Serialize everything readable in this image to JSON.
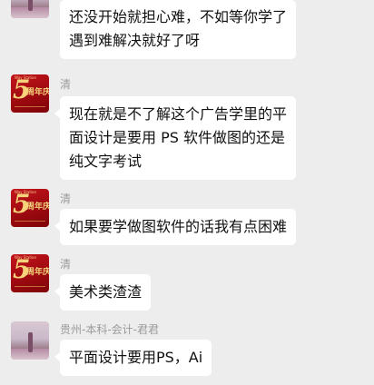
{
  "messages": [
    {
      "sender": "",
      "avatar": "photo-avatar",
      "lines": [
        "还没开始就担心难，不如等你学了",
        "遇到难解决就好了呀"
      ]
    },
    {
      "sender": "清",
      "avatar": "anniversary-badge-avatar",
      "lines": [
        "现在就是不了解这个广告学里的平",
        "面设计是要用 PS 软件做图的还是",
        "纯文字考试"
      ]
    },
    {
      "sender": "清",
      "avatar": "anniversary-badge-avatar",
      "lines": [
        "如果要学做图软件的话我有点困难"
      ]
    },
    {
      "sender": "清",
      "avatar": "anniversary-badge-avatar",
      "lines": [
        "美术类渣渣"
      ]
    },
    {
      "sender": "贵州-本科-会计-君君",
      "avatar": "photo-avatar",
      "lines": [
        "平面设计要用PS，Ai"
      ]
    }
  ],
  "avatar_badge": {
    "number": "5",
    "text": "周年庆典",
    "tag": "Way Station"
  },
  "colors": {
    "background": "#ededed",
    "bubble": "#ffffff",
    "badge_red": "#c4141c",
    "badge_gold": "#f6d37a"
  }
}
